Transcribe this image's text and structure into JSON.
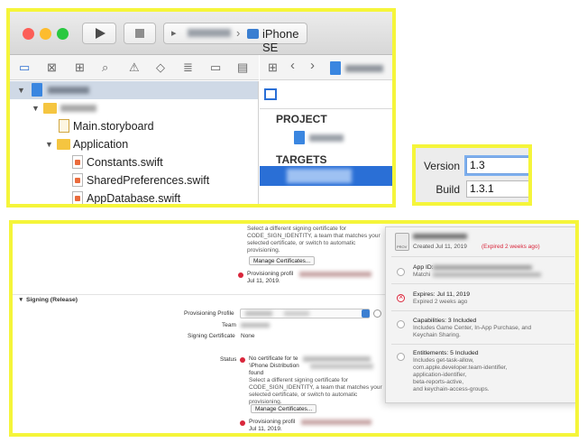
{
  "xcode": {
    "toolbar": {
      "device": "iPhone SE"
    },
    "navigator": {
      "files": [
        {
          "label": "Main.storyboard"
        },
        {
          "label": "Application"
        },
        {
          "label": "Constants.swift"
        },
        {
          "label": "SharedPreferences.swift"
        },
        {
          "label": "AppDatabase.swift"
        }
      ]
    },
    "editor": {
      "project_header": "PROJECT",
      "targets_header": "TARGETS"
    }
  },
  "identity": {
    "version_label": "Version",
    "version_value": "1.3",
    "build_label": "Build",
    "build_value": "1.3.1"
  },
  "signing": {
    "top_hint": [
      "Select a different signing certificate for",
      "CODE_SIGN_IDENTITY, a team that matches your",
      "selected certificate, or switch to automatic",
      "provisioning."
    ],
    "manage_certs": "Manage Certificates...",
    "prov_error_1": "Provisioning profil",
    "prov_error_1b": "Jul 11, 2019.",
    "section_title": "Signing (Release)",
    "provisioning_profile_label": "Provisioning Profile",
    "team_label": "Team",
    "signing_cert_label": "Signing Certificate",
    "signing_cert_value": "None",
    "status_label": "Status",
    "status_lines": [
      "No certificate for te",
      "'iPhone Distribution",
      "found"
    ],
    "status_hint": [
      "Select a different signing certificate for",
      "CODE_SIGN_IDENTITY, a team that matches your",
      "selected certificate, or switch to automatic",
      "provisioning."
    ],
    "manage_certs_2": "Manage Certificates...",
    "prov_error_2": "Provisioning profil",
    "prov_error_2b": "Jul 11, 2019."
  },
  "profile_popup": {
    "created": "Created Jul 11, 2019",
    "expired_note": "(Expired 2 weeks ago)",
    "app_id_label": "App ID:",
    "matching_label": "Matchi",
    "expires_title": "Expires: Jul 11, 2019",
    "expires_sub": "Expired 2 weeks ago",
    "capabilities_title": "Capabilities: 3 Included",
    "capabilities_sub": [
      "Includes Game Center, In-App Purchase, and",
      "Keychain Sharing."
    ],
    "entitlements_title": "Entitlements: 5 Included",
    "entitlements_sub": [
      "Includes get-task-allow,",
      "com.apple.developer.team-identifier,",
      "application-identifier,",
      "beta-reports-active,",
      "and keychain-access-groups."
    ],
    "prov_badge": "PROV"
  },
  "colors": {
    "highlight": "#f5f53a",
    "selection_blue": "#2a6fd6",
    "error_red": "#d9263b"
  }
}
